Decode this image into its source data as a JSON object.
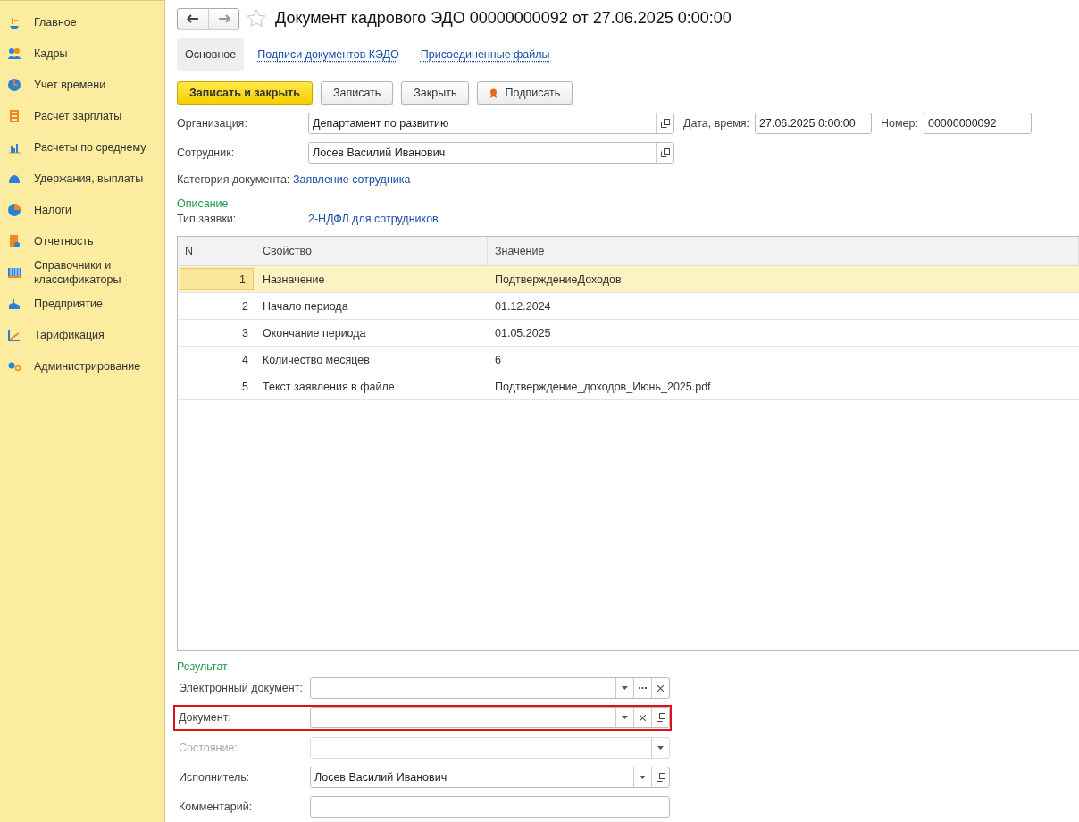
{
  "sidebar": {
    "items": [
      {
        "label": "Главное"
      },
      {
        "label": "Кадры"
      },
      {
        "label": "Учет времени"
      },
      {
        "label": "Расчет зарплаты"
      },
      {
        "label": "Расчеты по среднему"
      },
      {
        "label": "Удержания, выплаты"
      },
      {
        "label": "Налоги"
      },
      {
        "label": "Отчетность"
      },
      {
        "label": "Справочники и классификаторы"
      },
      {
        "label": "Предприятие"
      },
      {
        "label": "Тарификация"
      },
      {
        "label": "Администрирование"
      }
    ]
  },
  "window": {
    "title": "Документ кадрового ЭДО 00000000092 от 27.06.2025 0:00:00"
  },
  "tabs": [
    {
      "label": "Основное",
      "selected": true
    },
    {
      "label": "Подписи документов КЭДО",
      "selected": false
    },
    {
      "label": "Присоединенные файлы",
      "selected": false
    }
  ],
  "toolbar": [
    {
      "label": "Записать и закрыть",
      "kind": "primary"
    },
    {
      "label": "Записать",
      "kind": "plain"
    },
    {
      "label": "Закрыть",
      "kind": "plain"
    },
    {
      "label": "Подписать",
      "kind": "sign"
    }
  ],
  "organization": {
    "label": "Организация:",
    "value": "Департамент по развитию"
  },
  "date": {
    "label": "Дата, время:",
    "value": "27.06.2025  0:00:00"
  },
  "number": {
    "label": "Номер:",
    "value": "00000000092"
  },
  "employee": {
    "label": "Сотрудник:",
    "value": "Лосев Василий Иванович"
  },
  "category": {
    "label": "Категория документа:",
    "value": "Заявление сотрудника"
  },
  "description": {
    "heading": "Описание",
    "label": "Тип заявки:",
    "value": "2-НДФЛ для сотрудников"
  },
  "table": {
    "columns": [
      "N",
      "Свойство",
      "Значение"
    ],
    "rows": [
      {
        "cells": [
          "1",
          "Назначение",
          "ПодтверждениеДоходов"
        ],
        "selected": true
      },
      {
        "cells": [
          "2",
          "Начало периода",
          "01.12.2024"
        ],
        "selected": false
      },
      {
        "cells": [
          "3",
          "Окончание периода",
          "01.05.2025"
        ],
        "selected": false
      },
      {
        "cells": [
          "4",
          "Количество месяцев",
          "6"
        ],
        "selected": false
      },
      {
        "cells": [
          "5",
          "Текст заявления в файле",
          "Подтверждение_доходов_Июнь_2025.pdf"
        ],
        "selected": false
      }
    ]
  },
  "result": {
    "heading": "Результат",
    "fields": [
      {
        "label": "Электронный документ:",
        "kind": "choice",
        "disabled": false
      },
      {
        "label": "Документ:",
        "kind": "reference",
        "disabled": false,
        "highlighted": true
      },
      {
        "label": "Состояние:",
        "kind": "select",
        "disabled": true
      },
      {
        "label": "Исполнитель:",
        "value": "Лосев Василий Иванович",
        "kind": "lookup",
        "disabled": false
      },
      {
        "label": "Комментарий:",
        "kind": "text",
        "disabled": false
      }
    ]
  }
}
